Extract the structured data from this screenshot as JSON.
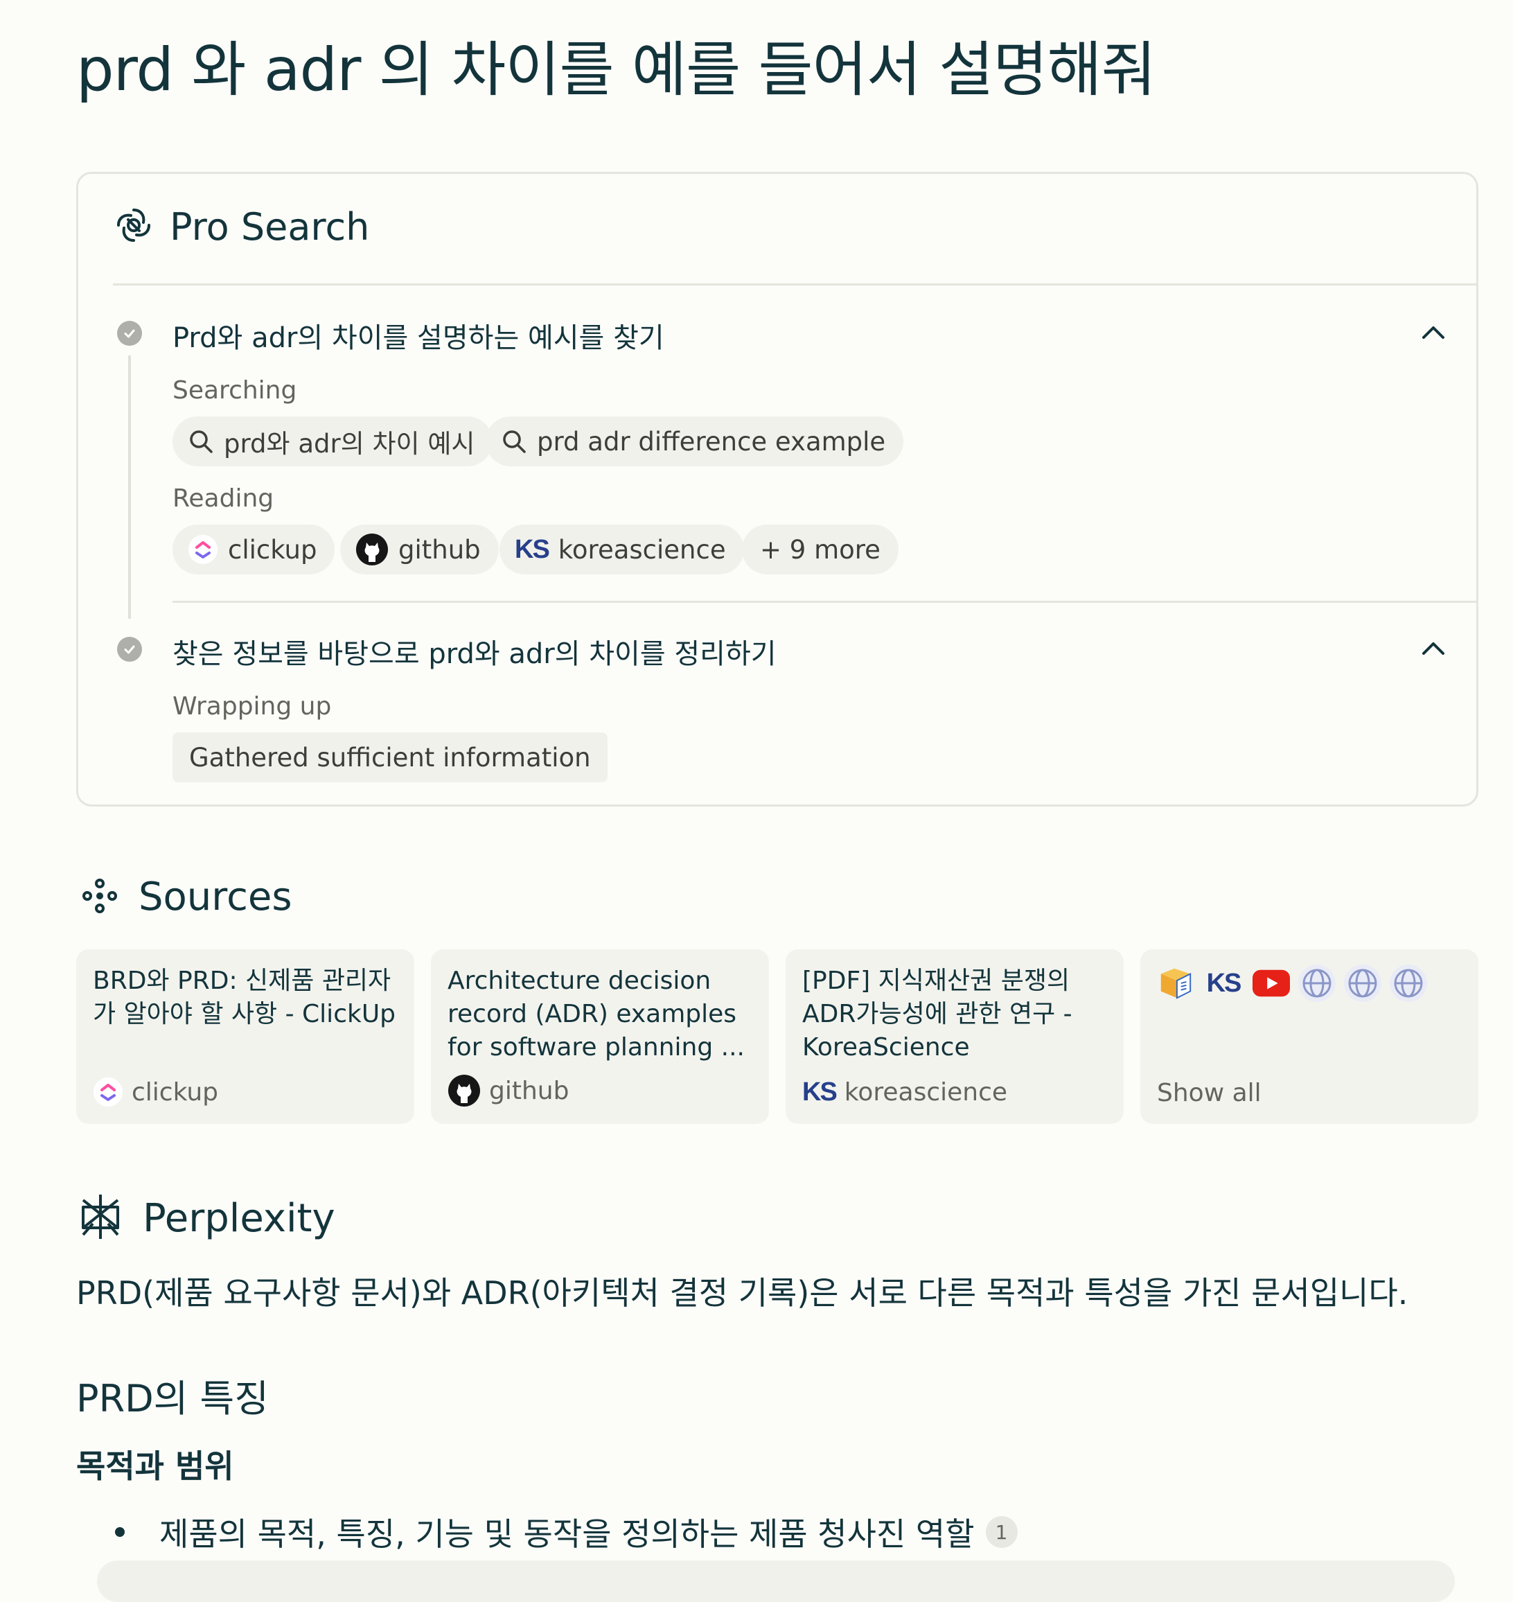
{
  "query": "prd 와 adr 의 차이를 예를 들어서 설명해줘",
  "pro_search": {
    "title": "Pro Search",
    "steps": [
      {
        "title": "Prd와 adr의 차이를 설명하는 예시를 찾기",
        "searching_label": "Searching",
        "queries": [
          "prd와 adr의 차이 예시",
          "prd adr difference example"
        ],
        "reading_label": "Reading",
        "reading": [
          {
            "name": "clickup",
            "icon": "clickup-icon"
          },
          {
            "name": "github",
            "icon": "github-icon"
          },
          {
            "name": "koreascience",
            "icon": "koreascience-icon"
          }
        ],
        "more": "+ 9 more"
      },
      {
        "title": "찾은 정보를 바탕으로 prd와 adr의 차이를 정리하기",
        "wrapping_label": "Wrapping up",
        "wrapping_chip": "Gathered sufficient information"
      }
    ]
  },
  "sources": {
    "title": "Sources",
    "items": [
      {
        "title": "BRD와 PRD: 신제품 관리자가 알아야 할 사항 - ClickUp",
        "domain": "clickup",
        "icon": "clickup-icon"
      },
      {
        "title": "Architecture decision record (ADR) examples for software planning ...",
        "domain": "github",
        "icon": "github-icon"
      },
      {
        "title": "[PDF] 지식재산권 분쟁의 ADR가능성에 관한 연구 - KoreaScience",
        "domain": "koreascience",
        "icon": "koreascience-icon"
      }
    ],
    "show_all": "Show all",
    "ks_text": "KS"
  },
  "answer": {
    "title": "Perplexity",
    "intro": "PRD(제품 요구사항 문서)와 ADR(아키텍처 결정 기록)은 서로 다른 목적과 특성을 가진 문서입니다.",
    "h2": "PRD의 특징",
    "h3": "목적과 범위",
    "bullets": [
      {
        "text": "제품의 목적, 특징, 기능 및 동작을 정의하는 제품 청사진 역할",
        "cite": "1"
      }
    ]
  },
  "colors": {
    "background": "#fcfcf9",
    "text": "#13343b",
    "muted": "#64645f",
    "chip": "#f1f1ec",
    "border": "#e5e5de"
  }
}
